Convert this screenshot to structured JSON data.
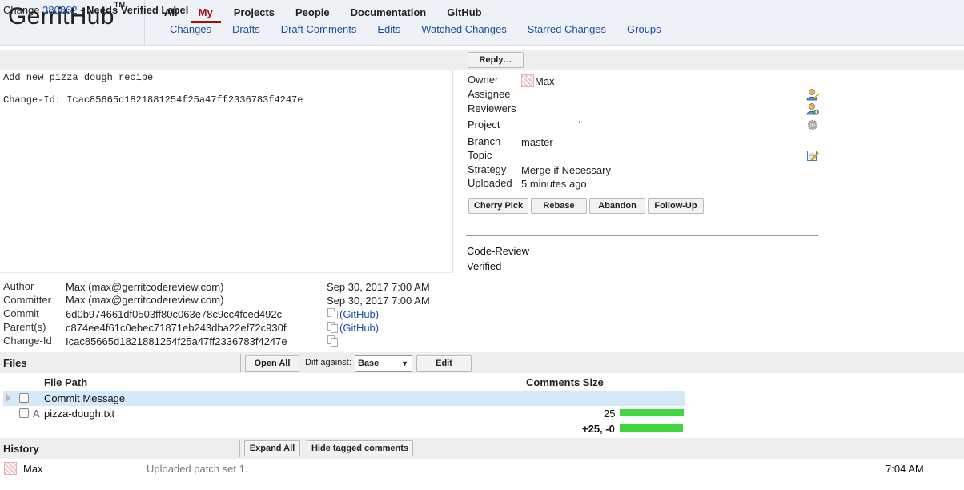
{
  "header": {
    "logo": "GerritHub",
    "logo_tm": "TM",
    "top_menu": [
      "All",
      "My",
      "Projects",
      "People",
      "Documentation",
      "GitHub"
    ],
    "active_top": "My",
    "sub_menu": [
      "Changes",
      "Drafts",
      "Draft Comments",
      "Edits",
      "Watched Changes",
      "Starred Changes",
      "Groups"
    ]
  },
  "change": {
    "prefix": "Change",
    "number": "380862",
    "separator": "-",
    "status": "Needs Verified Label",
    "reply_label": "Reply…",
    "commit_message": "Add new pizza dough recipe\n\nChange-Id: Icac85665d1821881254f25a47ff2336783f4247e"
  },
  "info": {
    "owner_label": "Owner",
    "owner": "Max",
    "assignee_label": "Assignee",
    "reviewers_label": "Reviewers",
    "project_label": "Project",
    "branch_label": "Branch",
    "branch": "master",
    "topic_label": "Topic",
    "strategy_label": "Strategy",
    "strategy": "Merge if Necessary",
    "uploaded_label": "Uploaded",
    "uploaded": "5 minutes ago",
    "actions": [
      "Cherry Pick",
      "Rebase",
      "Abandon",
      "Follow-Up"
    ],
    "labels": [
      "Code-Review",
      "Verified"
    ]
  },
  "meta": {
    "author_label": "Author",
    "author": "Max (max@gerritcodereview.com)",
    "author_date": "Sep 30, 2017 7:00 AM",
    "committer_label": "Committer",
    "committer": "Max (max@gerritcodereview.com)",
    "committer_date": "Sep 30, 2017 7:00 AM",
    "commit_label": "Commit",
    "commit": "6d0b974661df0503ff80c063e78c9cc4fced492c",
    "commit_link": "(GitHub)",
    "parent_label": "Parent(s)",
    "parent": "c874ee4f61c0ebec71871eb243dba22ef72c930f",
    "parent_link": "(GitHub)",
    "changeid_label": "Change-Id",
    "changeid": "Icac85665d1821881254f25a47ff2336783f4247e"
  },
  "files": {
    "title": "Files",
    "open_all": "Open All",
    "diff_against_label": "Diff against:",
    "diff_against_value": "Base",
    "edit": "Edit",
    "col_path": "File Path",
    "col_comments_size": "Comments Size",
    "rows": [
      {
        "status": "",
        "path": "Commit Message",
        "size": ""
      },
      {
        "status": "A",
        "path": "pizza-dough.txt",
        "size": "25"
      }
    ],
    "total": "+25, -0"
  },
  "history": {
    "title": "History",
    "expand_all": "Expand All",
    "hide_tagged": "Hide tagged comments",
    "entries": [
      {
        "author": "Max",
        "message": "Uploaded patch set 1.",
        "time": "7:04 AM"
      }
    ]
  }
}
